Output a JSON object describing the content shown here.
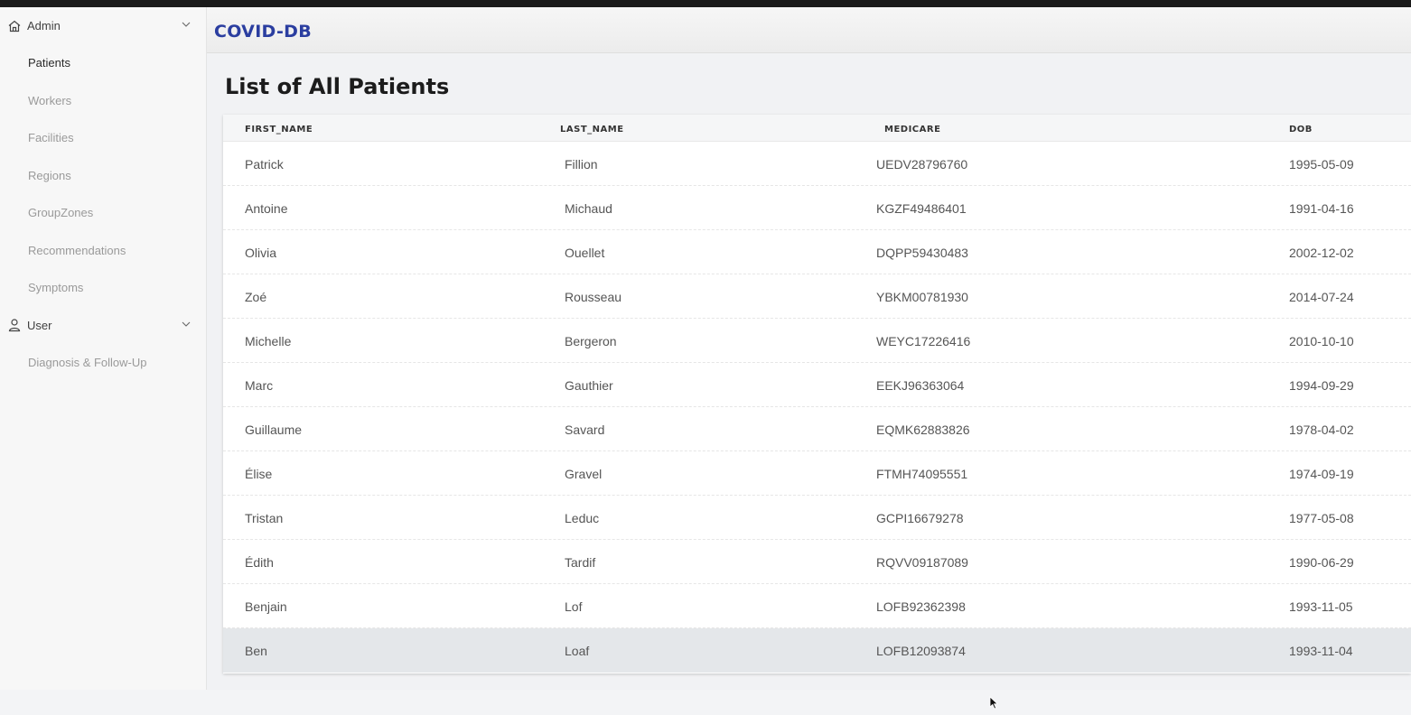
{
  "app": {
    "brand": "COVID-DB"
  },
  "sidebar": {
    "sections": [
      {
        "label": "Admin",
        "icon": "home-icon"
      },
      {
        "label": "User",
        "icon": "user-icon"
      }
    ],
    "admin_items": [
      {
        "label": "Patients"
      },
      {
        "label": "Workers"
      },
      {
        "label": "Facilities"
      },
      {
        "label": "Regions"
      },
      {
        "label": "GroupZones"
      },
      {
        "label": "Recommendations"
      },
      {
        "label": "Symptoms"
      }
    ],
    "user_items": [
      {
        "label": "Diagnosis & Follow-Up"
      }
    ]
  },
  "main": {
    "title": "List of All Patients",
    "table": {
      "headers": [
        "FIRST_NAME",
        "LAST_NAME",
        "MEDICARE",
        "DOB"
      ],
      "rows": [
        [
          "Patrick",
          "Fillion",
          "UEDV28796760",
          "1995-05-09"
        ],
        [
          "Antoine",
          "Michaud",
          "KGZF49486401",
          "1991-04-16"
        ],
        [
          "Olivia",
          "Ouellet",
          "DQPP59430483",
          "2002-12-02"
        ],
        [
          "Zoé",
          "Rousseau",
          "YBKM00781930",
          "2014-07-24"
        ],
        [
          "Michelle",
          "Bergeron",
          "WEYC17226416",
          "2010-10-10"
        ],
        [
          "Marc",
          "Gauthier",
          "EEKJ96363064",
          "1994-09-29"
        ],
        [
          "Guillaume",
          "Savard",
          "EQMK62883826",
          "1978-04-02"
        ],
        [
          "Élise",
          "Gravel",
          "FTMH74095551",
          "1974-09-19"
        ],
        [
          "Tristan",
          "Leduc",
          "GCPI16679278",
          "1977-05-08"
        ],
        [
          "Édith",
          "Tardif",
          "RQVV09187089",
          "1990-06-29"
        ],
        [
          "Benjain",
          "Lof",
          "LOFB92362398",
          "1993-11-05"
        ],
        [
          "Ben",
          "Loaf",
          "LOFB12093874",
          "1993-11-04"
        ]
      ]
    }
  },
  "colors": {
    "brand": "#2b3ea0",
    "hover_row": "#e4e7ea"
  }
}
